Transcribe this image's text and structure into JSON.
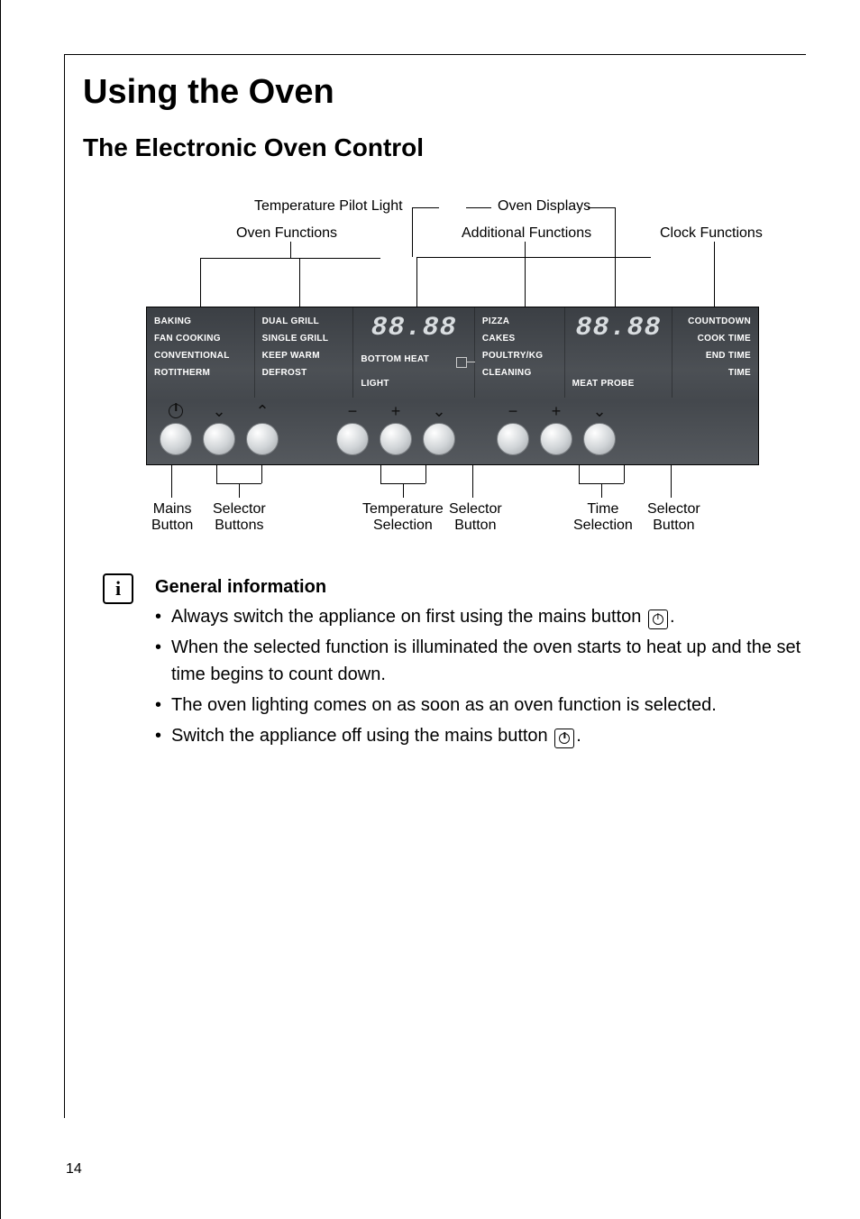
{
  "page_number": "14",
  "h1": "Using the Oven",
  "h2": "The Electronic Oven Control",
  "top_labels": {
    "temp_pilot": "Temperature Pilot Light",
    "oven_displays": "Oven Displays",
    "oven_functions": "Oven Functions",
    "additional_functions": "Additional Functions",
    "clock_functions": "Clock Functions"
  },
  "panel": {
    "oven_funcs_col1": [
      "BAKING",
      "FAN COOKING",
      "CONVENTIONAL",
      "ROTITHERM"
    ],
    "oven_funcs_col2": [
      "DUAL GRILL",
      "SINGLE GRILL",
      "KEEP WARM",
      "DEFROST"
    ],
    "temp_display": "88.88",
    "bottom_heat": "BOTTOM HEAT",
    "light": "LIGHT",
    "additional": [
      "PIZZA",
      "CAKES",
      "POULTRY/KG",
      "CLEANING"
    ],
    "clock_display": "88.88",
    "meat_probe": "MEAT PROBE",
    "clock_funcs": [
      "COUNTDOWN",
      "COOK TIME",
      "END TIME",
      "TIME"
    ]
  },
  "bottom_labels": {
    "mains": "Mains\nButton",
    "selector_buttons": "Selector\nButtons",
    "temp_selection": "Temperature\nSelection",
    "selector_button_mid": "Selector\nButton",
    "time_selection": "Time\nSelection",
    "selector_button_right": "Selector\nButton"
  },
  "info": {
    "heading": "General information",
    "bullets": [
      {
        "pre": "Always switch the appliance on first using the mains button ",
        "icon": true,
        "post": "."
      },
      {
        "pre": "When the selected function is illuminated the oven starts to heat up and the set time begins to count down.",
        "icon": false,
        "post": ""
      },
      {
        "pre": "The oven lighting comes on as soon as an oven function is selected.",
        "icon": false,
        "post": ""
      },
      {
        "pre": "Switch the appliance off using the mains button ",
        "icon": true,
        "post": "."
      }
    ]
  }
}
